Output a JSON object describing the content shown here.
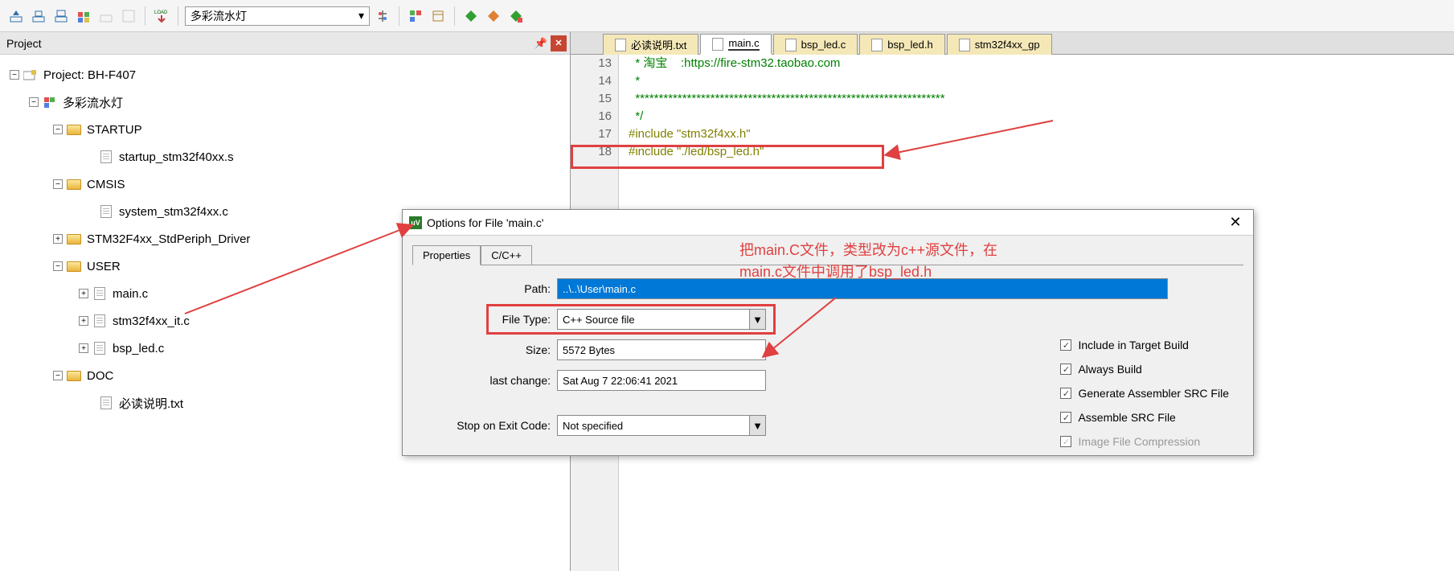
{
  "toolbar": {
    "target_name": "多彩流水灯"
  },
  "project_panel": {
    "title": "Project",
    "root": "Project: BH-F407",
    "target": "多彩流水灯",
    "groups": [
      {
        "name": "STARTUP",
        "files": [
          "startup_stm32f40xx.s"
        ]
      },
      {
        "name": "CMSIS",
        "files": [
          "system_stm32f4xx.c"
        ]
      },
      {
        "name": "STM32F4xx_StdPeriph_Driver",
        "files": []
      },
      {
        "name": "USER",
        "files": [
          "main.c",
          "stm32f4xx_it.c",
          "bsp_led.c"
        ]
      },
      {
        "name": "DOC",
        "files": [
          "必读说明.txt"
        ]
      }
    ]
  },
  "editor": {
    "tabs": [
      {
        "name": "必读说明.txt",
        "active": false
      },
      {
        "name": "main.c",
        "active": true
      },
      {
        "name": "bsp_led.c",
        "active": false
      },
      {
        "name": "bsp_led.h",
        "active": false
      },
      {
        "name": "stm32f4xx_gp",
        "active": false
      }
    ],
    "lines": [
      {
        "num": "13",
        "text": "  * 淘宝    :https://fire-stm32.taobao.com",
        "cls": "comment"
      },
      {
        "num": "14",
        "text": "  *",
        "cls": "comment"
      },
      {
        "num": "15",
        "text": "  ******************************************************************",
        "cls": "comment"
      },
      {
        "num": "16",
        "text": "  */",
        "cls": "comment"
      },
      {
        "num": "17",
        "text": "#include \"stm32f4xx.h\"",
        "cls": "preproc"
      },
      {
        "num": "18",
        "text": "#include \"./led/bsp_led.h\"",
        "cls": "preproc"
      }
    ]
  },
  "dialog": {
    "title": "Options for File 'main.c'",
    "tabs": [
      "Properties",
      "C/C++"
    ],
    "path_label": "Path:",
    "path_value": "..\\..\\User\\main.c",
    "filetype_label": "File Type:",
    "filetype_value": "C++ Source file",
    "size_label": "Size:",
    "size_value": "5572 Bytes",
    "lastchange_label": "last change:",
    "lastchange_value": "Sat Aug  7 22:06:41 2021",
    "stopcode_label": "Stop on Exit Code:",
    "stopcode_value": "Not specified",
    "checkboxes": [
      {
        "label": "Include in Target Build",
        "checked": true,
        "disabled": false
      },
      {
        "label": "Always Build",
        "checked": true,
        "disabled": false
      },
      {
        "label": "Generate Assembler SRC File",
        "checked": true,
        "disabled": false
      },
      {
        "label": "Assemble SRC File",
        "checked": true,
        "disabled": false
      },
      {
        "label": "Image File Compression",
        "checked": true,
        "disabled": true
      }
    ]
  },
  "annotation": {
    "text1": "把main.C文件，类型改为c++源文件，在",
    "text2": "main.c文件中调用了bsp_led.h"
  }
}
